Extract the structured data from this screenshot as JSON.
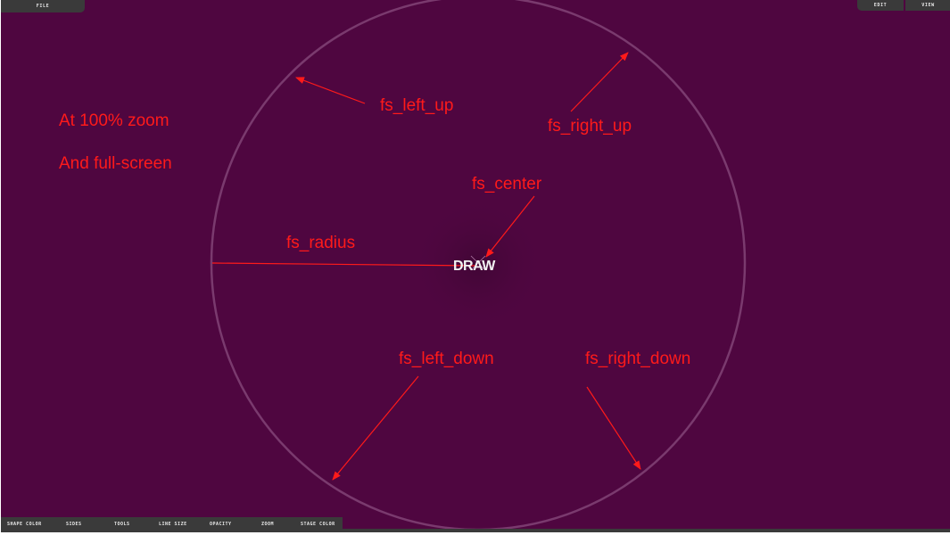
{
  "menu": {
    "file_label": "FILE",
    "edit_label": "EDIT",
    "view_label": "VIEW"
  },
  "toolbar": {
    "shape_color": "SHAPE COLOR",
    "sides": "SIDES",
    "tools": "TOOLS",
    "line_size": "LINE SIZE",
    "opacity": "OPACITY",
    "zoom": "ZOOM",
    "stage_color": "STAGE COLOR"
  },
  "canvas": {
    "logo": "DRAW",
    "stage_color": "#4f0640",
    "circle_color": "#7a3a6e"
  },
  "annotations": {
    "zoom_note": "At 100% zoom",
    "fullscreen_note": "And full-screen",
    "left_up": "fs_left_up",
    "right_up": "fs_right_up",
    "center": "fs_center",
    "radius": "fs_radius",
    "left_down": "fs_left_down",
    "right_down": "fs_right_down",
    "color": "#ff1a1a"
  }
}
